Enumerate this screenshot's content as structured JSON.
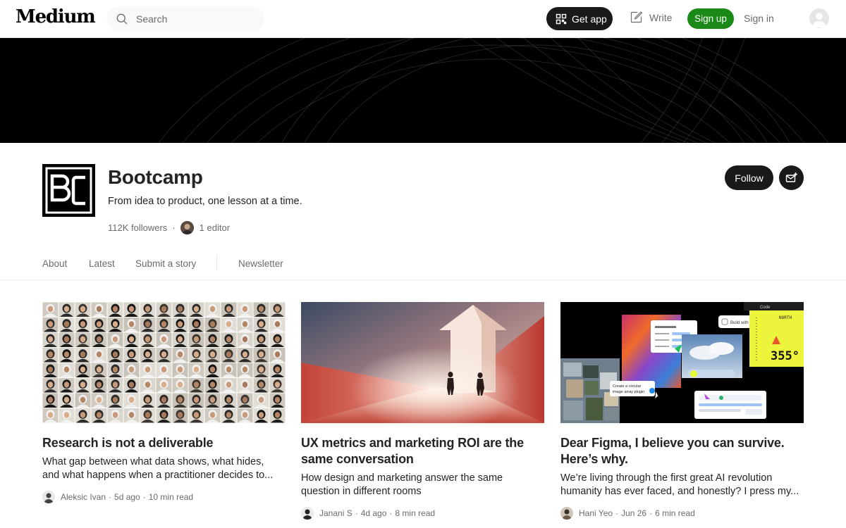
{
  "nav": {
    "logo": "Medium",
    "search_placeholder": "Search",
    "get_app": "Get app",
    "write": "Write",
    "sign_up": "Sign up",
    "sign_in": "Sign in"
  },
  "publication": {
    "logo_text": "BC",
    "name": "Bootcamp",
    "tagline": "From idea to product, one lesson at a time.",
    "followers": "112K followers",
    "separator": "·",
    "editors": "1 editor",
    "follow": "Follow"
  },
  "tabs": [
    {
      "label": "About"
    },
    {
      "label": "Latest"
    },
    {
      "label": "Submit a story"
    },
    {
      "label": "Newsletter"
    }
  ],
  "articles": [
    {
      "title_lines": [
        "Research is not a deliverable"
      ],
      "excerpt_lines": [
        "What gap between what data shows, what hides,",
        "and what happens when a practitioner decides to..."
      ],
      "author": "Aleksic Ivan",
      "date": "5d ago",
      "read_time": "10 min read"
    },
    {
      "title_lines": [
        "UX metrics and marketing ROI are the",
        "same conversation"
      ],
      "excerpt_lines": [
        "How design and marketing answer the same",
        "question in different rooms"
      ],
      "author": "Janani S",
      "date": "4d ago",
      "read_time": "8 min read"
    },
    {
      "title_lines": [
        "Dear Figma, I believe you can survive.",
        "Here’s why."
      ],
      "excerpt_lines": [
        "We’re living through the first great AI revolution",
        "humanity has ever faced, and honestly? I press my..."
      ],
      "author": "Hani Yeo",
      "date": "Jun 26",
      "read_time": "6 min read"
    }
  ],
  "figma_image": {
    "build_with_code": "Build with code",
    "create_plugin_line1": "Create a circular",
    "create_plugin_line2": "image array plugin",
    "compass_label": "NORTH",
    "compass_value": "355°",
    "code_tab": "Code"
  },
  "colors": {
    "accent_green": "#1a8917",
    "dark_button": "#191919",
    "muted_text": "#6b6b6b",
    "primary_text": "#242424"
  }
}
